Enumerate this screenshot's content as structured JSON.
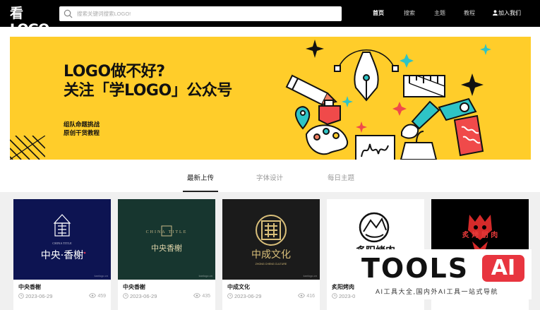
{
  "header": {
    "logo_text": "看LOGO",
    "search_placeholder": "搜索关键词搜索LOGO!",
    "nav": [
      {
        "label": "首页",
        "active": true
      },
      {
        "label": "搜索",
        "active": false
      },
      {
        "label": "主题",
        "active": false
      },
      {
        "label": "教程",
        "active": false
      },
      {
        "label": "加入我们",
        "active": false
      }
    ]
  },
  "banner": {
    "title_line1": "LOGO做不好?",
    "title_line2": "关注「学LOGO」公众号",
    "sub_line1": "组队命题挑战",
    "sub_line2": "原创干货教程",
    "bg_color": "#ffcd2a"
  },
  "tabs": [
    {
      "label": "最新上传",
      "active": true
    },
    {
      "label": "字体设计",
      "active": false
    },
    {
      "label": "每日主题",
      "active": false
    }
  ],
  "cards": [
    {
      "title": "中央香榭",
      "date": "2023-06-29",
      "views": "459",
      "bg": "#0d1452",
      "img_text": "中央·香榭",
      "img_small": "CHINA TITLE",
      "watermark": "kanlogo.cn"
    },
    {
      "title": "中央香榭",
      "date": "2023-06-29",
      "views": "435",
      "bg": "#17362f",
      "img_text": "中央香榭",
      "img_small": "CHINA  TITLE",
      "watermark": "kanlogo.cn"
    },
    {
      "title": "中成文化",
      "date": "2023-06-29",
      "views": "416",
      "bg": "#1b1b1b",
      "img_text": "中成文化",
      "img_small": "ZHONG CHENG CULTURE",
      "watermark": "kanlogo.cn"
    },
    {
      "title": "炙阳烤肉",
      "date": "2023-0",
      "views": "",
      "bg": "#ffffff",
      "img_text": "炙阳烤肉",
      "img_small": "",
      "watermark": ""
    },
    {
      "title": "",
      "date": "",
      "views": "",
      "bg": "#000000",
      "img_text": "炙 烤 朋 肉",
      "img_small": "",
      "watermark": ""
    }
  ],
  "overlay": {
    "brand": "TOOLS",
    "badge": "AI",
    "tagline": "AI工具大全,国内外AI工具一站式导航"
  }
}
